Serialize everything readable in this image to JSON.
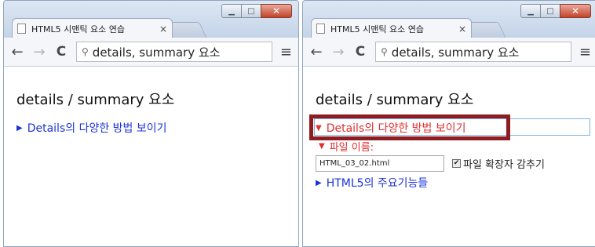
{
  "left": {
    "tab_title": "HTML5 시맨틱 요소 연습",
    "tab_close": "×",
    "address": "details, summary 요소",
    "heading": "details / summary 요소",
    "summary_marker": "▶",
    "summary_text": "Details의 다양한 방법 보이기"
  },
  "right": {
    "tab_title": "HTML5 시맨틱 요소 연습",
    "tab_close": "×",
    "address": "details, summary 요소",
    "heading": "details / summary 요소",
    "summary_marker": "▼",
    "summary_text": "Details의 다양한 방법 보이기",
    "filename_marker": "▼",
    "filename_label": "파일 이름:",
    "filename_value": "HTML_03_02.html",
    "checkbox_checked": true,
    "checkbox_mark": "✔",
    "checkbox_label": "파일 확장자 감추기",
    "summary2_marker": "▶",
    "summary2_text": "HTML5의 주요기능들"
  },
  "chrome": {
    "back": "←",
    "forward": "→",
    "reload": "C",
    "search_glyph": "⚲",
    "menu": "≡",
    "minimize": "▁",
    "maximize": "□",
    "close": "✕"
  },
  "colors": {
    "summary_closed": "#1c33d6",
    "summary_open": "#e02f2f",
    "highlight_border": "#8e1d22"
  }
}
